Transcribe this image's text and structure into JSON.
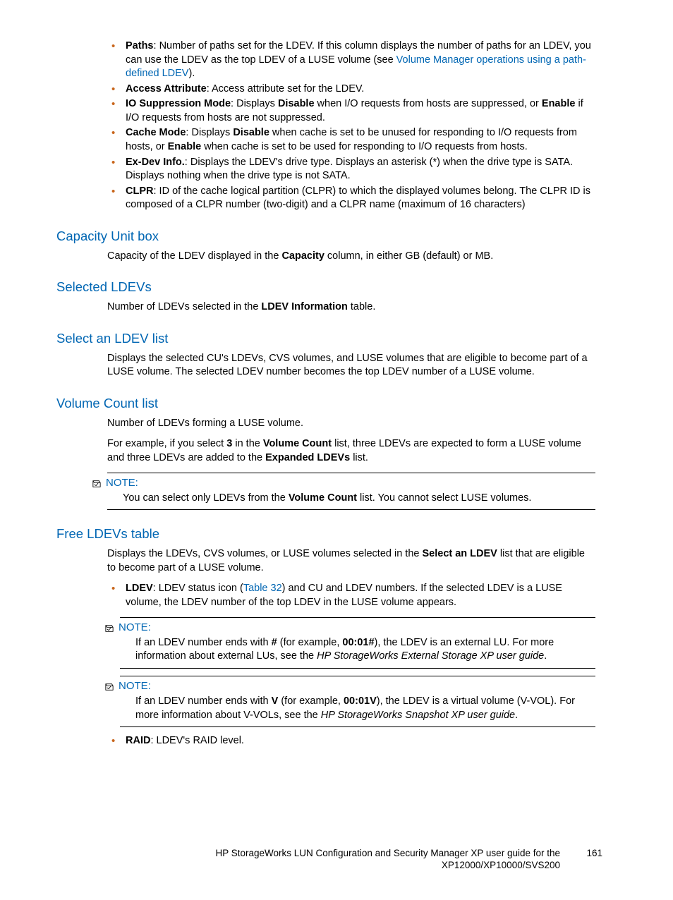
{
  "bullets_top": [
    {
      "term": "Paths",
      "text_parts": [
        "Number of paths set for the LDEV. If this column displays the number of paths for an LDEV, you can use the LDEV as the top LDEV of a LUSE volume (see ",
        {
          "link": "Volume Manager operations using a path-defined LDEV"
        },
        ")."
      ]
    },
    {
      "term": "Access Attribute",
      "text_parts": [
        "Access attribute set for the LDEV."
      ]
    },
    {
      "term": "IO Suppression Mode",
      "text_parts": [
        "Displays ",
        {
          "b": "Disable"
        },
        " when I/O requests from hosts are suppressed, or ",
        {
          "b": "Enable"
        },
        " if I/O requests from hosts are not suppressed."
      ]
    },
    {
      "term": "Cache Mode",
      "text_parts": [
        "Displays ",
        {
          "b": "Disable"
        },
        " when cache is set to be unused for responding to I/O requests from hosts, or ",
        {
          "b": "Enable"
        },
        " when cache is set to be used for responding to I/O requests from hosts."
      ]
    },
    {
      "term": "Ex-Dev Info.",
      "text_parts": [
        "Displays the LDEV's drive type. Displays an asterisk (*) when the drive type is SATA. Displays nothing when the drive type is not SATA."
      ]
    },
    {
      "term": "CLPR",
      "text_parts": [
        "ID of the cache logical partition (CLPR) to which the displayed volumes belong. The CLPR ID is composed of a CLPR number (two-digit) and a CLPR name (maximum of 16 characters)"
      ]
    }
  ],
  "sec_capacity": {
    "title": "Capacity Unit box",
    "para_parts": [
      "Capacity of the LDEV displayed in the ",
      {
        "b": "Capacity"
      },
      " column, in either GB (default) or MB."
    ]
  },
  "sec_selected": {
    "title": "Selected LDEVs",
    "para_parts": [
      "Number of LDEVs selected in the ",
      {
        "b": "LDEV Information"
      },
      " table."
    ]
  },
  "sec_selectan": {
    "title": "Select an LDEV list",
    "para": "Displays the selected CU's LDEVs, CVS volumes, and LUSE volumes that are eligible to become part of a LUSE volume. The selected LDEV number becomes the top LDEV number of a LUSE volume."
  },
  "sec_volcount": {
    "title": "Volume Count list",
    "p1": "Number of LDEVs forming a LUSE volume.",
    "p2_parts": [
      "For example, if you select ",
      {
        "b": "3"
      },
      " in the ",
      {
        "b": "Volume Count"
      },
      " list, three LDEVs are expected to form a LUSE volume and three LDEVs are added to the ",
      {
        "b": "Expanded LDEVs"
      },
      " list."
    ]
  },
  "note1": {
    "label": "NOTE:",
    "body_parts": [
      "You can select only LDEVs from the ",
      {
        "b": "Volume Count"
      },
      " list. You cannot select LUSE volumes."
    ]
  },
  "sec_free": {
    "title": "Free LDEVs table",
    "p1_parts": [
      "Displays the LDEVs, CVS volumes, or LUSE volumes selected in the ",
      {
        "b": "Select an LDEV"
      },
      " list that are eligible to become part of a LUSE volume."
    ],
    "b1": {
      "term": "LDEV",
      "text_parts": [
        "LDEV status icon (",
        {
          "link": "Table 32"
        },
        ") and CU and LDEV numbers. If the selected LDEV is a LUSE volume, the LDEV number of the top LDEV in the LUSE volume appears."
      ]
    },
    "b2": {
      "term": "RAID",
      "text_parts": [
        "LDEV's RAID level."
      ]
    }
  },
  "note2": {
    "label": "NOTE:",
    "body_parts": [
      "If an LDEV number ends with ",
      {
        "b": "#"
      },
      " (for example, ",
      {
        "b": "00:01#"
      },
      "), the LDEV is an external LU. For more information about external LUs, see the ",
      {
        "i": "HP StorageWorks External Storage XP user guide"
      },
      "."
    ]
  },
  "note3": {
    "label": "NOTE:",
    "body_parts": [
      "If an LDEV number ends with ",
      {
        "b": "V"
      },
      " (for example, ",
      {
        "b": "00:01V"
      },
      "), the LDEV is a virtual volume (V-VOL). For more information about V-VOLs, see the ",
      {
        "i": "HP StorageWorks Snapshot XP user guide"
      },
      "."
    ]
  },
  "footer": {
    "line1": "HP StorageWorks LUN Configuration and Security Manager XP user guide for the",
    "line2": "XP12000/XP10000/SVS200",
    "page": "161"
  }
}
